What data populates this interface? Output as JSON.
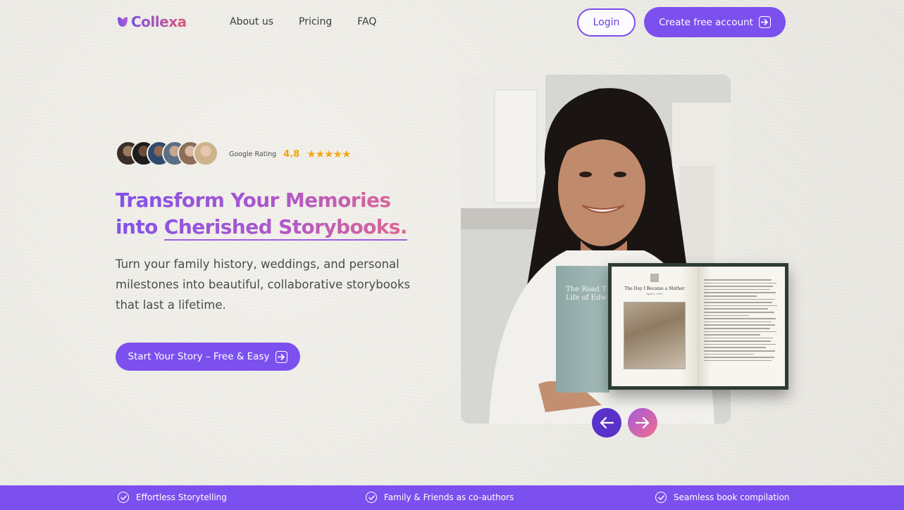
{
  "brand": {
    "name": "Collexa",
    "gradient_start": "#7a4fe6",
    "gradient_end": "#e0577d"
  },
  "nav": {
    "items": [
      "About us",
      "Pricing",
      "FAQ"
    ]
  },
  "header": {
    "login_label": "Login",
    "create_label": "Create free account"
  },
  "hero": {
    "rating_label": "Google Rating",
    "rating_value": "4.8",
    "stars": "★★★★★",
    "headline_line1": "Transform Your Memories",
    "headline_line2_prefix": "into",
    "headline_line2_underlined": "Cherished Storybooks.",
    "subtitle": "Turn your family history, weddings, and personal milestones into beautiful, collaborative storybooks that last a lifetime.",
    "cta_label": "Start Your Story – Free & Easy"
  },
  "book": {
    "cover_title": "The Road T Life of Edw",
    "chapter_title": "The Day I Became a Mother",
    "chapter_date": "April 2, 1983"
  },
  "features": [
    "Effortless Storytelling",
    "Family & Friends as co-authors",
    "Seamless book compilation"
  ],
  "colors": {
    "primary": "#7c50ee",
    "accent_pink": "#e56a8a",
    "star": "#f5a712",
    "background": "#efede8"
  },
  "icons": [
    "arrow-right-box-icon",
    "check-circle-icon",
    "arrow-left-icon",
    "arrow-right-icon",
    "star-icon"
  ]
}
